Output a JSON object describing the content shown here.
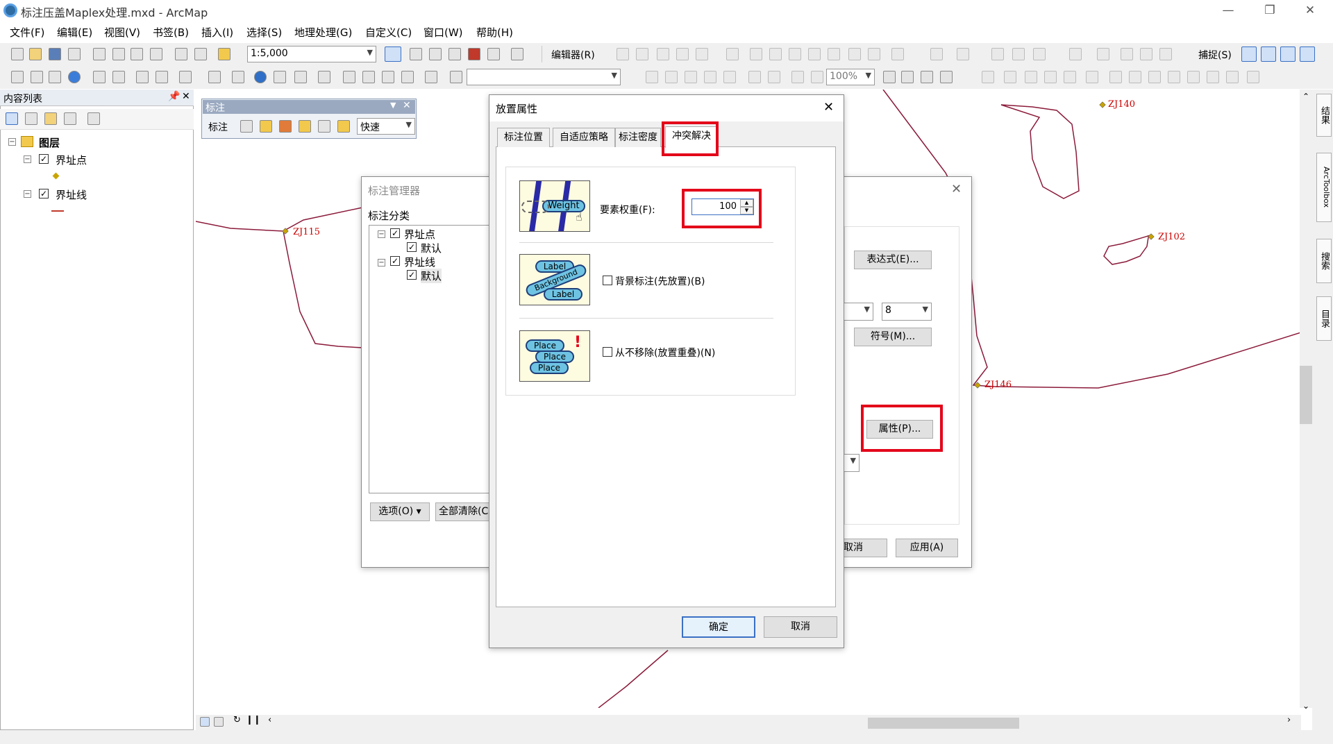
{
  "window": {
    "title": "标注压盖Maplex处理.mxd - ArcMap"
  },
  "menu": [
    "文件(F)",
    "编辑(E)",
    "视图(V)",
    "书签(B)",
    "插入(I)",
    "选择(S)",
    "地理处理(G)",
    "自定义(C)",
    "窗口(W)",
    "帮助(H)"
  ],
  "toolbar": {
    "scale": "1:5,000",
    "editor": "编辑器(R)",
    "snapping": "捕捉(S)",
    "zoom": "100%"
  },
  "toc": {
    "title": "内容列表",
    "root": "图层",
    "layers": [
      {
        "name": "界址点"
      },
      {
        "name": "界址线"
      }
    ]
  },
  "labeling_toolbar": {
    "title": "标注",
    "menu": "标注",
    "mode": "快速"
  },
  "map_labels": [
    "ZJ115",
    "ZJ140",
    "ZJ102",
    "ZJ146"
  ],
  "label_manager": {
    "title": "标注管理器",
    "section": "标注分类",
    "tree": [
      {
        "name": "界址点",
        "child": "默认"
      },
      {
        "name": "界址线",
        "child": "默认"
      }
    ],
    "options_button": "选项(O)",
    "clear_button": "全部清除(C",
    "expression_button": "表达式(E)...",
    "size_value": "8",
    "symbol_button": "符号(M)...",
    "properties_button": "属性(P)...",
    "cancel_button": "取消",
    "apply_button": "应用(A)"
  },
  "placement_dialog": {
    "title": "放置属性",
    "tabs": [
      "标注位置",
      "自适应策略",
      "标注密度",
      "冲突解决"
    ],
    "active_tab": "冲突解决",
    "feature_weight_label": "要素权重(F):",
    "feature_weight_value": "100",
    "background_label": "背景标注(先放置)(B)",
    "never_remove_label": "从不移除(放置重叠)(N)",
    "illus1_text": "Weight",
    "illus2_texts": [
      "Label",
      "Background",
      "Label"
    ],
    "illus3_texts": [
      "Place",
      "Place",
      "Place"
    ],
    "ok_button": "确定",
    "cancel_button": "取消"
  },
  "dock_tabs": [
    "结果",
    "ArcToolbox",
    "搜索",
    "目录"
  ],
  "colors": {
    "highlight": "#e3051a",
    "map_line": "#8b1a3a",
    "label": "#cc0000"
  }
}
